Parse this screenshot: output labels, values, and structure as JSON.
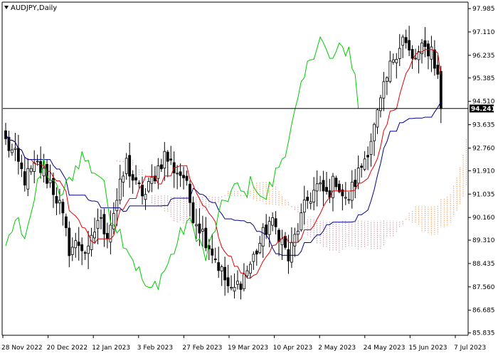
{
  "window": {
    "dropdown_icon": "triangle-down-icon",
    "title": "AUDJPY,Daily"
  },
  "colors": {
    "background": "#ffffff",
    "candle": "#000000",
    "tenkan": "#e00000",
    "kijun": "#00008b",
    "chikou": "#00cc00",
    "cloud_bear": "#c89aa8",
    "cloud_bull": "#f2a060",
    "price_line": "#000000",
    "price_tag_bg": "#000000",
    "price_tag_text": "#ffffff"
  },
  "current_price": {
    "label": "94.241",
    "value": 94.241
  },
  "chart_data": {
    "type": "candlestick",
    "title": "AUDJPY,Daily",
    "ylim": [
      85.8,
      98.2
    ],
    "y_ticks": [
      "97.985",
      "97.110",
      "96.235",
      "95.385",
      "94.510",
      "93.635",
      "92.760",
      "91.910",
      "91.035",
      "90.160",
      "89.310",
      "88.435",
      "87.560",
      "86.685",
      "85.835"
    ],
    "x_ticks": [
      "28 Nov 2022",
      "20 Dec 2022",
      "12 Jan 2023",
      "3 Feb 2023",
      "27 Feb 2023",
      "19 Mar 2023",
      "10 Apr 2023",
      "2 May 2023",
      "24 May 2023",
      "15 Jun 2023",
      "7 Jul 2023"
    ],
    "grid": false,
    "close_series_anchors": [
      [
        0,
        93.0
      ],
      [
        3,
        92.4
      ],
      [
        6,
        91.6
      ],
      [
        10,
        92.1
      ],
      [
        14,
        91.5
      ],
      [
        17,
        90.6
      ],
      [
        20,
        89.0
      ],
      [
        23,
        89.2
      ],
      [
        26,
        88.8
      ],
      [
        29,
        90.1
      ],
      [
        32,
        89.6
      ],
      [
        35,
        90.8
      ],
      [
        38,
        92.2
      ],
      [
        41,
        91.3
      ],
      [
        44,
        91.0
      ],
      [
        47,
        91.8
      ],
      [
        50,
        92.5
      ],
      [
        53,
        92.0
      ],
      [
        56,
        91.7
      ],
      [
        59,
        90.3
      ],
      [
        62,
        89.6
      ],
      [
        65,
        88.9
      ],
      [
        68,
        88.1
      ],
      [
        71,
        87.3
      ],
      [
        74,
        87.8
      ],
      [
        77,
        88.4
      ],
      [
        80,
        89.2
      ],
      [
        83,
        90.0
      ],
      [
        86,
        89.6
      ],
      [
        89,
        88.6
      ],
      [
        92,
        89.8
      ],
      [
        95,
        90.8
      ],
      [
        98,
        91.3
      ],
      [
        101,
        91.0
      ],
      [
        104,
        91.6
      ],
      [
        107,
        90.7
      ],
      [
        110,
        91.5
      ],
      [
        113,
        92.4
      ],
      [
        116,
        93.5
      ],
      [
        119,
        94.9
      ],
      [
        122,
        96.2
      ],
      [
        125,
        96.9
      ],
      [
        128,
        96.0
      ],
      [
        131,
        96.4
      ],
      [
        134,
        96.5
      ],
      [
        136,
        95.4
      ],
      [
        137,
        94.24
      ]
    ],
    "last_close": 94.241
  }
}
